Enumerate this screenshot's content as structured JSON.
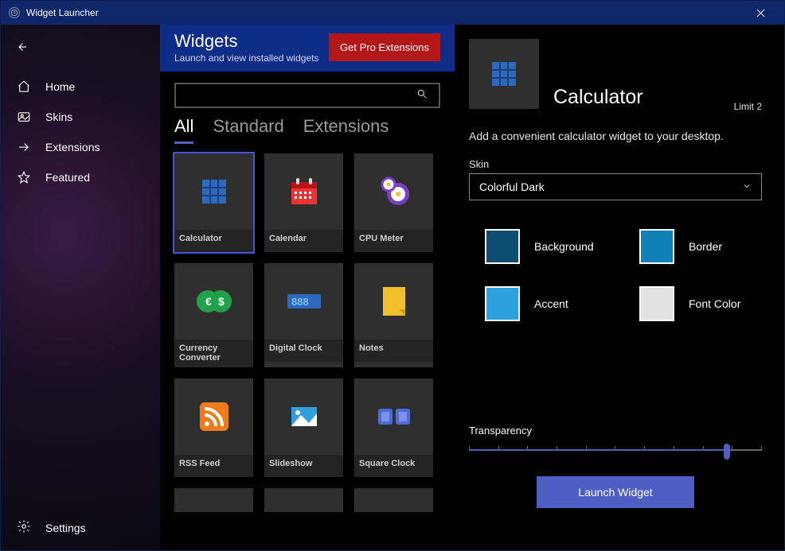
{
  "window": {
    "title": "Widget Launcher"
  },
  "sidebar": {
    "items": [
      {
        "id": "home",
        "label": "Home"
      },
      {
        "id": "skins",
        "label": "Skins"
      },
      {
        "id": "extensions",
        "label": "Extensions"
      },
      {
        "id": "featured",
        "label": "Featured"
      }
    ],
    "settings_label": "Settings"
  },
  "header": {
    "title": "Widgets",
    "subtitle": "Launch and view installed widgets",
    "pro_button": "Get Pro Extensions"
  },
  "tabs": {
    "items": [
      "All",
      "Standard",
      "Extensions"
    ],
    "active_index": 0
  },
  "widgets": {
    "items": [
      {
        "id": "calculator",
        "label": "Calculator",
        "selected": true
      },
      {
        "id": "calendar",
        "label": "Calendar"
      },
      {
        "id": "cpu-meter",
        "label": "CPU Meter"
      },
      {
        "id": "currency-converter",
        "label": "Currency Converter"
      },
      {
        "id": "digital-clock",
        "label": "Digital Clock"
      },
      {
        "id": "notes",
        "label": "Notes"
      },
      {
        "id": "rss-feed",
        "label": "RSS Feed"
      },
      {
        "id": "slideshow",
        "label": "Slideshow"
      },
      {
        "id": "square-clock",
        "label": "Square Clock"
      }
    ]
  },
  "detail": {
    "title": "Calculator",
    "limit": "Limit 2",
    "description": "Add a convenient calculator widget to your desktop.",
    "skin_label": "Skin",
    "skin_value": "Colorful Dark",
    "swatches": [
      {
        "id": "background",
        "label": "Background",
        "color": "#0d4c73"
      },
      {
        "id": "border",
        "label": "Border",
        "color": "#1180b8"
      },
      {
        "id": "accent",
        "label": "Accent",
        "color": "#2ea0dc"
      },
      {
        "id": "font-color",
        "label": "Font Color",
        "color": "#e2e2e2"
      }
    ],
    "transparency_label": "Transparency",
    "launch_label": "Launch Widget"
  }
}
